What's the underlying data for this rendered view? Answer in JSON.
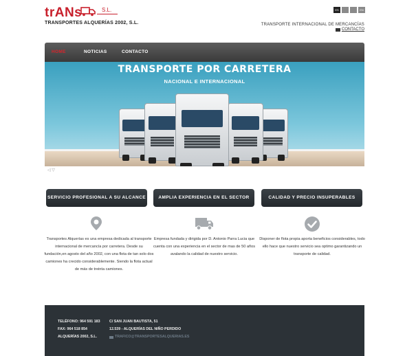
{
  "header": {
    "logo_text": "trANs",
    "logo_sl": "S.L.",
    "company_name": "TRANSPORTES ALQUERÍAS 2002, S.L.",
    "tagline": "TRANSPORTE INTERNACIONAL DE MERCANCÍAS",
    "contact_link": "CONTACTO",
    "languages": [
      "ES",
      "",
      "",
      "EN"
    ]
  },
  "nav": {
    "items": [
      "HOME",
      "NOTICIAS",
      "CONTACTO"
    ]
  },
  "banner": {
    "title": "TRANSPORTE POR CARRETERA",
    "subtitle": "NACIONAL E INTERNACIONAL"
  },
  "features": [
    {
      "button": "SERVICIO PROFESIONAL A SU ALCANCE",
      "icon": "map-marker-icon",
      "text": "Transportes Alquerías es una empresa dedicada al transporte internacional de mercancía por carretera. Desde su fundación,en agosto del año 2002, con una flota de tan solo dos camiones ha crecido considerablemente. Siendo la flota actual de más de treinta camiones."
    },
    {
      "button": "AMPLIA EXPERIENCIA EN EL SECTOR",
      "icon": "truck-icon",
      "text": "Empresa fundada y dirigida por D. Antonio Parra Lucia que cuenta con una experiencia en el sector de mas de 50 años avalando la calidad de nuestro servicio."
    },
    {
      "button": "CALIDAD Y PRECIO INSUPERABLES",
      "icon": "check-circle-icon",
      "text": "Disponer de flota propia aporta beneficios considerables, todo ello hace que nuestro servicio sea optimo garantizando un transporte de calidad."
    }
  ],
  "footer": {
    "phone": "TELÉFONO: 964 591 183",
    "fax": "FAX: 964 518 854",
    "company": "ALQUERÍAS 2002, S.L.",
    "street": "C/ SAN JUAN BAUTISTA, 51",
    "city": "12.539 - ALQUERÍAS DEL NIÑO PERDIDO",
    "email": "TRAFICO@TRANSPORTESALQUERIAS.ES"
  },
  "colors": {
    "brand_red": "#c8202c",
    "nav_dark": "#3a3a3a",
    "footer_bg": "#2c3237"
  }
}
